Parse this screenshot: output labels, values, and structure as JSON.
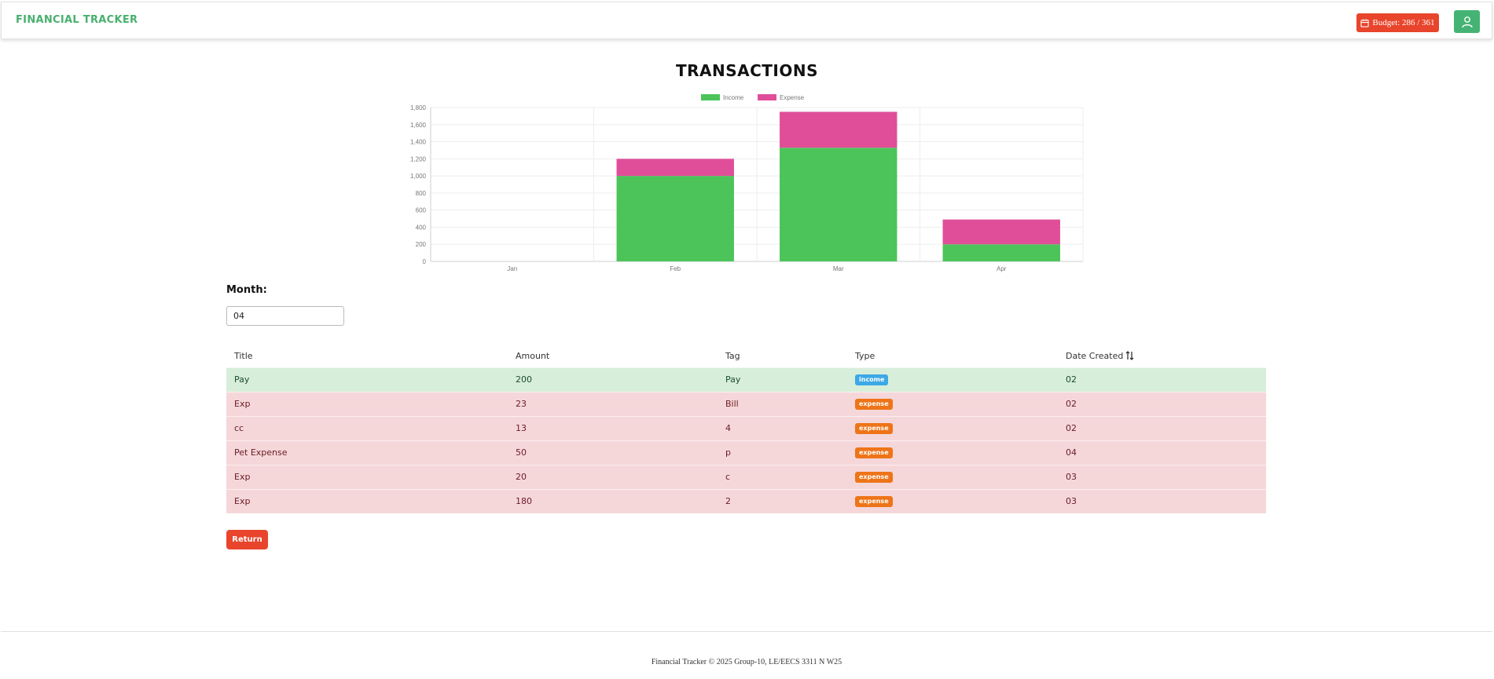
{
  "app": {
    "brand": "FINANCIAL TRACKER",
    "brand_color": "#48b06e"
  },
  "header": {
    "budget_label": "Budget: 286 / 361",
    "budget_icon": "calendar-icon",
    "user_icon": "user-icon"
  },
  "page": {
    "title": "TRANSACTIONS"
  },
  "chart_data": {
    "type": "bar",
    "stacked": true,
    "categories": [
      "Jan",
      "Feb",
      "Mar",
      "Apr"
    ],
    "series": [
      {
        "name": "Income",
        "values": [
          0,
          1000,
          1330,
          200
        ],
        "color": "#4cc45a"
      },
      {
        "name": "Expense",
        "values": [
          0,
          200,
          420,
          290
        ],
        "color": "#e04e99"
      }
    ],
    "ylim": [
      0,
      1800
    ],
    "y_ticks": [
      "0",
      "200",
      "400",
      "600",
      "800",
      "1,000",
      "1,200",
      "1,400",
      "1,600",
      "1,800"
    ],
    "grid": true,
    "legend_position": "top-center",
    "title": "",
    "xlabel": "",
    "ylabel": ""
  },
  "filter": {
    "month_label": "Month:",
    "month_value": "04"
  },
  "table": {
    "columns": [
      "Title",
      "Amount",
      "Tag",
      "Type",
      "Date Created"
    ],
    "rows": [
      {
        "title": "Pay",
        "amount": "200",
        "tag": "Pay",
        "type": "income",
        "date": "02"
      },
      {
        "title": "Exp",
        "amount": "23",
        "tag": "Bill",
        "type": "expense",
        "date": "02"
      },
      {
        "title": "cc",
        "amount": "13",
        "tag": "4",
        "type": "expense",
        "date": "02"
      },
      {
        "title": "Pet Expense",
        "amount": "50",
        "tag": "p",
        "type": "expense",
        "date": "04"
      },
      {
        "title": "Exp",
        "amount": "20",
        "tag": "c",
        "type": "expense",
        "date": "03"
      },
      {
        "title": "Exp",
        "amount": "180",
        "tag": "2",
        "type": "expense",
        "date": "03"
      }
    ]
  },
  "actions": {
    "return_label": "Return"
  },
  "footer": {
    "text": "Financial Tracker © 2025 Group-10, LE/EECS 3311 N W25"
  },
  "colors": {
    "accent_red": "#e8452c",
    "accent_green": "#45b374",
    "income_row": "#d7eedb",
    "expense_row": "#f5d7da"
  }
}
